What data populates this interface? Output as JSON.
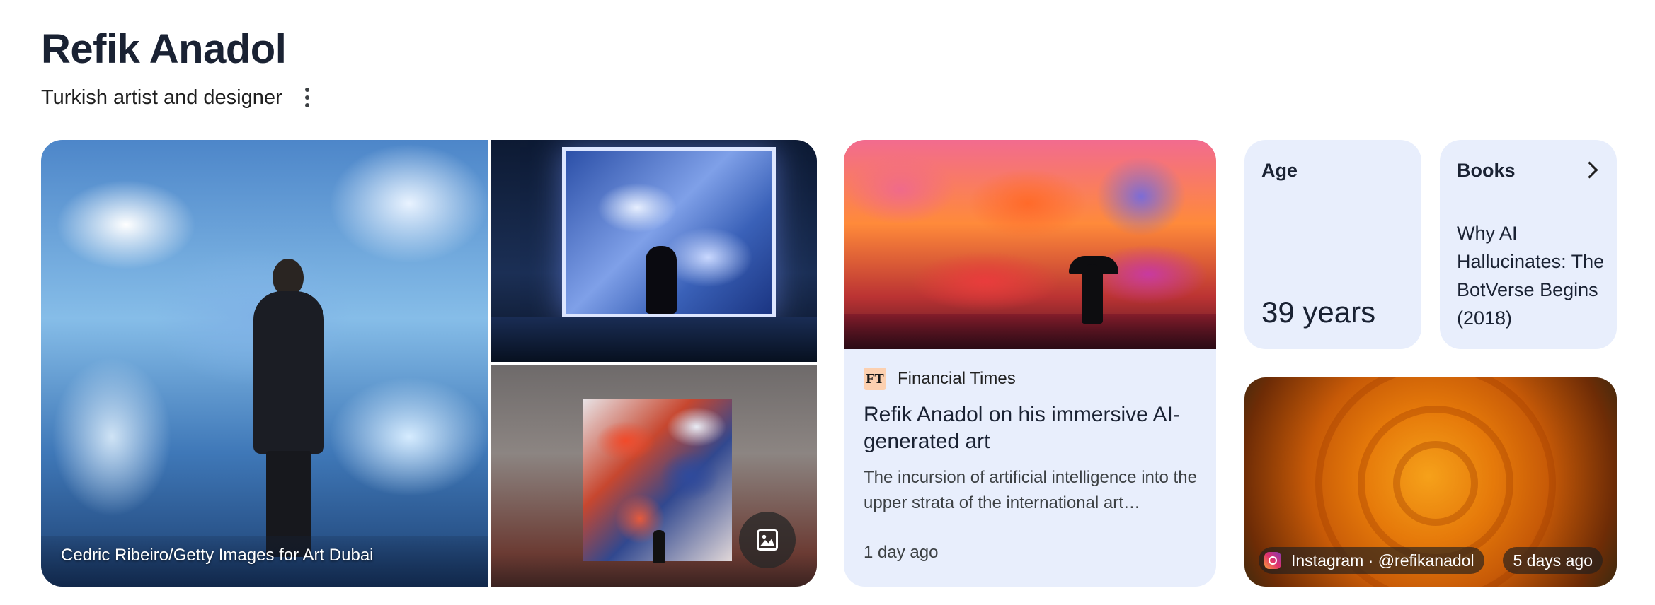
{
  "header": {
    "title": "Refik Anadol",
    "subtitle": "Turkish artist and designer"
  },
  "images": {
    "main_credit": "Cedric Ribeiro/Getty Images for Art Dubai"
  },
  "news": {
    "source_logo": "FT",
    "source": "Financial Times",
    "headline": "Refik Anadol on his immersive AI-generated art",
    "snippet": "The incursion of artificial intelligence into the upper strata of the international art…",
    "time": "1 day ago"
  },
  "age": {
    "label": "Age",
    "value": "39 years"
  },
  "books": {
    "label": "Books",
    "title": "Why AI Hallucinates: The BotVerse Begins (2018)"
  },
  "instagram": {
    "handle": "Instagram · @refikanadol",
    "time": "5 days ago"
  },
  "icons": {
    "more": "more-vert-icon",
    "gallery": "image-gallery-icon",
    "chevron": "chevron-right-icon",
    "instagram": "instagram-icon"
  }
}
